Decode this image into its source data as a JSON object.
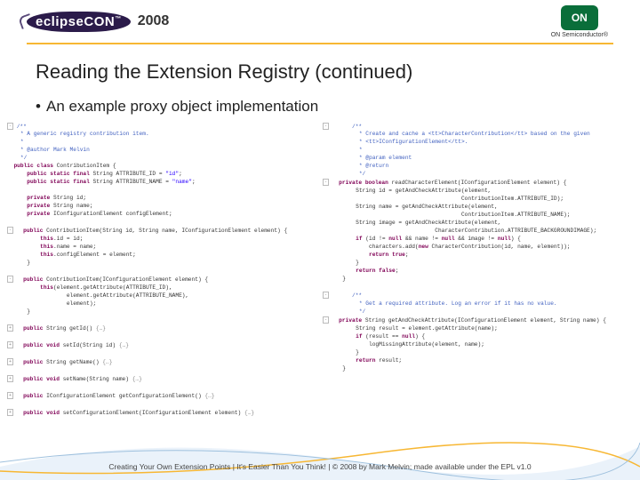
{
  "header": {
    "conf_name": "eclipseCON",
    "tm": "™",
    "year": "2008",
    "on_label": "ON",
    "on_sub": "ON Semiconductor",
    "on_tm": "®"
  },
  "slide": {
    "title": "Reading the Extension Registry (continued)",
    "bullet": "An example proxy object implementation"
  },
  "code_left": {
    "jd1": "/**",
    "jd2": " * A generic registry contribution item.",
    "jd3": " * ",
    "jd4": " * @author Mark Melvin",
    "jd5": " */",
    "l_class": "public class ContributionItem {",
    "l_attr_id": "    public static final String ATTRIBUTE_ID = \"id\";",
    "l_attr_name": "    public static final String ATTRIBUTE_NAME = \"name\";",
    "l_blank1": "",
    "l_fid": "    private String id;",
    "l_fname": "    private String name;",
    "l_fce": "    private IConfigurationElement configElement;",
    "l_blank2": "",
    "l_ctor1": "    public ContributionItem(String id, String name, IConfigurationElement element) {",
    "l_ctor1b": "        this.id = id;",
    "l_ctor1c": "        this.name = name;",
    "l_ctor1d": "        this.configElement = element;",
    "l_ctor1e": "    }",
    "l_blank3": "",
    "l_ctor2": "    public ContributionItem(IConfigurationElement element) {",
    "l_ctor2b": "        this(element.getAttribute(ATTRIBUTE_ID),",
    "l_ctor2c": "                element.getAttribute(ATTRIBUTE_NAME),",
    "l_ctor2d": "                element);",
    "l_ctor2e": "    }",
    "l_blank4": "",
    "l_getid": "    public String getId()",
    "l_setid": "    public void setId(String id)",
    "l_getname": "    public String getName()",
    "l_setname": "    public void setName(String name)",
    "l_getce": "    public IConfigurationElement getConfigurationElement()",
    "l_setce": "    public void setConfigurationElement(IConfigurationElement element)"
  },
  "code_right": {
    "jd1": "    /**",
    "jd2": "     * Create and cache a <tt>CharacterContribution</tt> based on the given",
    "jd3": "     * <tt>IConfigurationElement</tt>.",
    "jd4": "     * ",
    "jd5": "     * @param element",
    "jd6": "     * @return",
    "jd7": "     */",
    "r_m1": "    private boolean readCharacterElement(IConfigurationElement element) {",
    "r_m1b": "        String id = getAndCheckAttribute(element,",
    "r_m1c": "                                        ContributionItem.ATTRIBUTE_ID);",
    "r_m1d": "        String name = getAndCheckAttribute(element,",
    "r_m1e": "                                        ContributionItem.ATTRIBUTE_NAME);",
    "r_m1f": "        String image = getAndCheckAttribute(element,",
    "r_m1g": "                                CharacterContribution.ATTRIBUTE_BACKGROUNDIMAGE);",
    "r_m1h": "        if (id != null && name != null && image != null) {",
    "r_m1i": "            characters.add(new CharacterContribution(id, name, element));",
    "r_m1j": "            return true;",
    "r_m1k": "        }",
    "r_m1l": "        return false;",
    "r_m1m": "    }",
    "r_blank": "",
    "jd8": "    /**",
    "jd9": "     * Get a required attribute. Log an error if it has no value.",
    "jd10": "     */",
    "r_m2": "    private String getAndCheckAttribute(IConfigurationElement element, String name) {",
    "r_m2b": "        String result = element.getAttribute(name);",
    "r_m2c": "        if (result == null) {",
    "r_m2d": "            logMissingAttribute(element, name);",
    "r_m2e": "        }",
    "r_m2f": "        return result;",
    "r_m2g": "    }"
  },
  "footer": {
    "text": "Creating Your Own Extension Points  |  It's Easier Than You Think!  |  © 2008 by Mark Melvin; made available under the EPL v1.0"
  }
}
